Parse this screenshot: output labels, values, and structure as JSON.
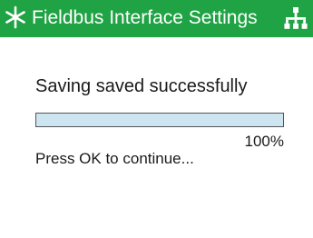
{
  "header": {
    "title": "Fieldbus Interface Settings",
    "left_icon": "settings-asterisk-icon",
    "right_icon": "fieldbus-network-icon",
    "background_color": "#1fa344",
    "text_color": "#ffffff"
  },
  "status": {
    "message": "Saving saved successfully",
    "progress_value": 100,
    "progress_label": "100%",
    "progress_fill_color": "#cde5f0",
    "prompt": "Press OK to continue..."
  }
}
